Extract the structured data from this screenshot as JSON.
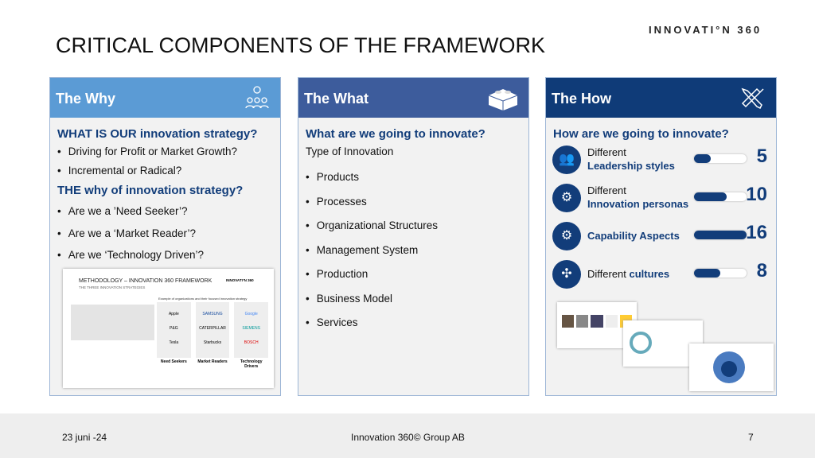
{
  "title": "CRITICAL COMPONENTS OF THE FRAMEWORK",
  "logo": "INNOVATI°N 360",
  "why": {
    "header": "The Why",
    "icon": "people-lightbulb-icon",
    "q1": "WHAT IS OUR innovation strategy?",
    "items1": [
      "Driving for Profit or Market Growth?",
      "Incremental or Radical?"
    ],
    "q2": "THE why of innovation strategy?",
    "items2": [
      "Are we a ’Need Seeker’?",
      "Are we a ‘Market Reader’?",
      "Are we ‘Technology Driven’?"
    ],
    "thumb": {
      "title": "METHODOLOGY – INNOVATION 360 FRAMEWORK",
      "subtitle": "THE THREE INNOVATION STRATEGIES",
      "caption": "Example of organizations and their focused innovation strategy",
      "cols": [
        {
          "name": "Need Seekers",
          "logos": [
            "Apple",
            "P&G",
            "Tesla"
          ]
        },
        {
          "name": "Market Readers",
          "logos": [
            "SAMSUNG",
            "CATERPILLAR",
            "Starbucks"
          ]
        },
        {
          "name": "Technology Drivers",
          "logos": [
            "Google",
            "SIEMENS",
            "BOSCH"
          ]
        }
      ]
    }
  },
  "what": {
    "header": "The What",
    "icon": "lego-brick-icon",
    "q": "What are we going to innovate?",
    "intro": "Type of Innovation",
    "items": [
      "Products",
      "Processes",
      "Organizational Structures",
      "Management System",
      "Production",
      "Business Model",
      "Services"
    ]
  },
  "how": {
    "header": "The How",
    "icon": "tools-icon",
    "q": "How are we going to innovate?",
    "rows": [
      {
        "pre": "Different",
        "label": "Leadership styles",
        "value": 5,
        "icon": "people-group-icon"
      },
      {
        "pre": "Different",
        "label": "Innovation personas",
        "value": 10,
        "icon": "head-gear-icon"
      },
      {
        "pre": "",
        "label": "Capability Aspects",
        "value": 16,
        "icon": "gear-icon"
      },
      {
        "pre": "Different ",
        "label": "cultures",
        "value": 8,
        "icon": "puzzle-icon"
      }
    ],
    "max": 16
  },
  "footer": {
    "date": "23 juni -24",
    "company": "Innovation 360© Group AB",
    "page": "7"
  },
  "colors": {
    "why": "#5b9bd5",
    "what": "#3d5c9c",
    "how": "#0f3b78"
  }
}
